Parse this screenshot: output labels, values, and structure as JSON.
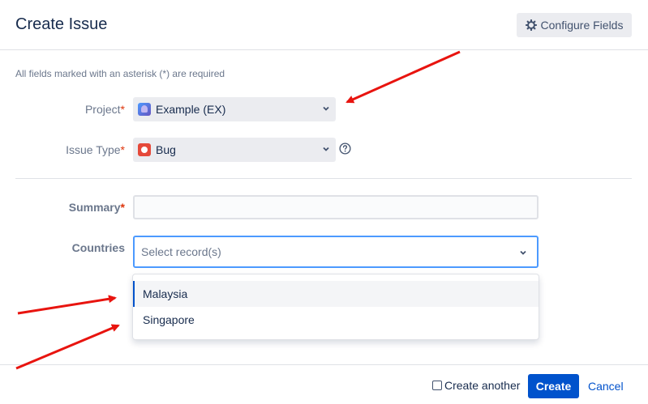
{
  "dialog": {
    "title": "Create Issue",
    "configure_fields_label": "Configure Fields",
    "required_note": "All fields marked with an asterisk (*) are required"
  },
  "fields": {
    "project": {
      "label": "Project",
      "required_mark": "*",
      "value": "Example (EX)"
    },
    "issue_type": {
      "label": "Issue Type",
      "required_mark": "*",
      "value": "Bug"
    },
    "summary": {
      "label": "Summary",
      "required_mark": "*",
      "value": ""
    },
    "countries": {
      "label": "Countries",
      "placeholder": "Select record(s)",
      "options": [
        "Malaysia",
        "Singapore"
      ]
    }
  },
  "footer": {
    "create_another_label": "Create another",
    "create_label": "Create",
    "cancel_label": "Cancel"
  },
  "colors": {
    "primary": "#0052cc",
    "focus_border": "#4c9aff",
    "annotation_arrow": "#e8140f",
    "required_star": "#de350b"
  },
  "icons": [
    "gear-icon",
    "project-avatar-icon",
    "bug-icon",
    "chevron-down-icon",
    "help-icon"
  ]
}
